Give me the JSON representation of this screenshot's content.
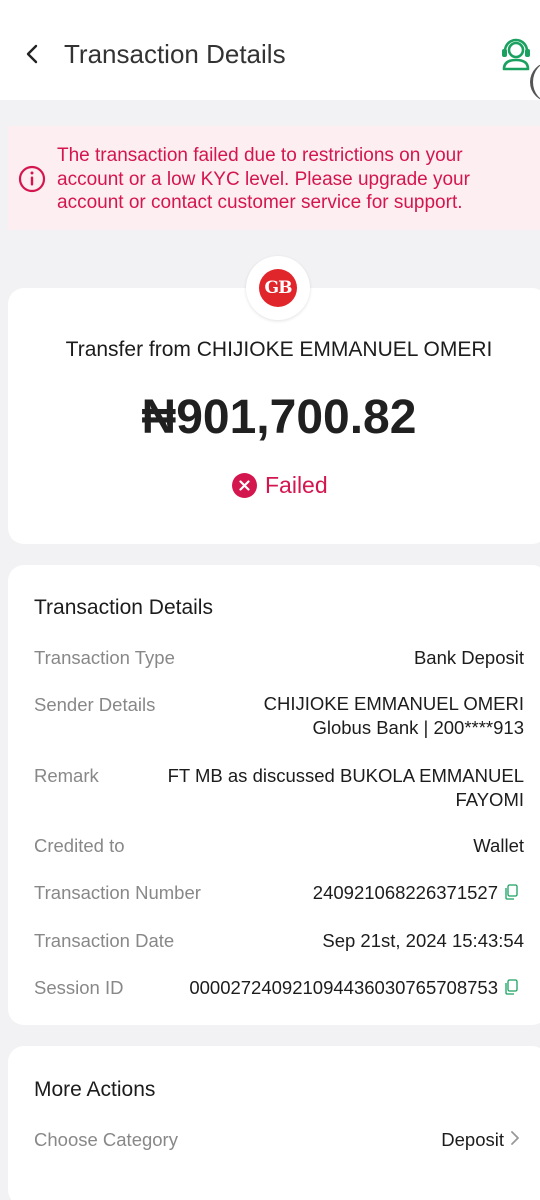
{
  "header": {
    "title": "Transaction Details",
    "back_icon": "chevron-left-icon",
    "support_icon": "customer-support-icon",
    "accent_color": "#1aa160"
  },
  "alert": {
    "icon": "info-circle-icon",
    "message": "The transaction failed due to restrictions on your account or a low KYC level. Please upgrade your account or contact customer service for support.",
    "color": "#d4164f"
  },
  "summary": {
    "bank_logo_text": "GB",
    "title": "Transfer from CHIJIOKE EMMANUEL OMERI",
    "amount": "₦901,700.82",
    "status": "Failed",
    "status_color": "#d4164f"
  },
  "details": {
    "title": "Transaction Details",
    "rows": [
      {
        "label": "Transaction Type",
        "value": "Bank Deposit"
      },
      {
        "label": "Sender Details",
        "value": "CHIJIOKE EMMANUEL OMERI",
        "value2": "Globus Bank | 200****913"
      },
      {
        "label": "Remark",
        "value": "FT MB as discussed BUKOLA EMMANUEL",
        "value2": "FAYOMI"
      },
      {
        "label": "Credited to",
        "value": "Wallet"
      },
      {
        "label": "Transaction Number",
        "value": "240921068226371527"
      },
      {
        "label": "Transaction Date",
        "value": "Sep 21st, 2024 15:43:54"
      },
      {
        "label": "Session ID",
        "value": "000027240921094436030765708753"
      }
    ]
  },
  "actions": {
    "title": "More Actions",
    "category_label": "Choose Category",
    "category_value": "Deposit"
  }
}
